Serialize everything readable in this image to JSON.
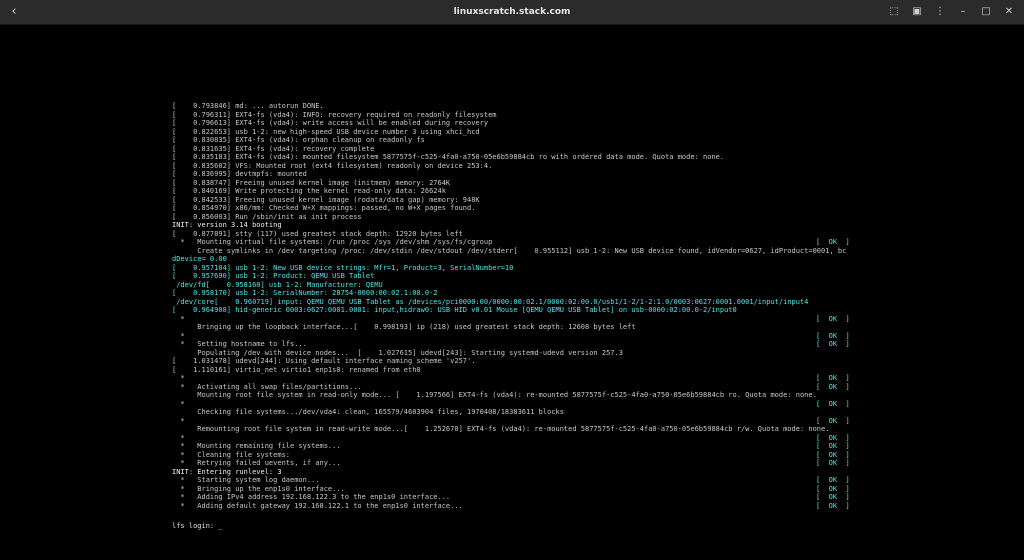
{
  "browser": {
    "title": "linuxscratch.stack.com",
    "back_icon": "back-arrow-icon",
    "icons": [
      "select-region-icon",
      "camera-icon",
      "more-options-icon",
      "minimize-icon",
      "maximize-icon",
      "close-icon"
    ]
  },
  "terminal": {
    "lines": [
      {
        "text": "[    0.793846] md: ... autorun DONE.",
        "cls": "",
        "ok": ""
      },
      {
        "text": "[    0.796311] EXT4-fs (vda4): INFO: recovery required on readonly filesystem",
        "cls": "",
        "ok": ""
      },
      {
        "text": "[    0.796613] EXT4-fs (vda4): write access will be enabled during recovery",
        "cls": "",
        "ok": ""
      },
      {
        "text": "[    0.822653] usb 1-2: new high-speed USB device number 3 using xhci_hcd",
        "cls": "",
        "ok": ""
      },
      {
        "text": "[    0.830835] EXT4-fs (vda4): orphan cleanup on readonly fs",
        "cls": "",
        "ok": ""
      },
      {
        "text": "[    0.831635] EXT4-fs (vda4): recovery complete",
        "cls": "",
        "ok": ""
      },
      {
        "text": "[    0.835183] EXT4-fs (vda4): mounted filesystem 5877575f-c525-4fa0-a750-05e6b59884cb ro with ordered data mode. Quota mode: none.",
        "cls": "",
        "ok": ""
      },
      {
        "text": "[    0.835602] VFS: Mounted root (ext4 filesystem) readonly on device 253:4.",
        "cls": "",
        "ok": ""
      },
      {
        "text": "[    0.836995] devtmpfs: mounted",
        "cls": "",
        "ok": ""
      },
      {
        "text": "[    0.838747] Freeing unused kernel image (initmem) memory: 2764K",
        "cls": "",
        "ok": ""
      },
      {
        "text": "[    0.840169] Write protecting the kernel read-only data: 26624k",
        "cls": "",
        "ok": ""
      },
      {
        "text": "[    0.842533] Freeing unused kernel image (rodata/data gap) memory: 948K",
        "cls": "",
        "ok": ""
      },
      {
        "text": "[    0.854970] x86/mm: Checked W+X mappings: passed, no W+X pages found.",
        "cls": "",
        "ok": ""
      },
      {
        "text": "[    0.856003] Run /sbin/init as init process",
        "cls": "",
        "ok": ""
      },
      {
        "text": "INIT: version 3.14 booting",
        "cls": "bright",
        "ok": ""
      },
      {
        "text": "[    0.877891] stty (117) used greatest stack depth: 12920 bytes left",
        "cls": "",
        "ok": ""
      },
      {
        "text": "  *   Mounting virtual file systems: /run /proc /sys /dev/shm /sys/fs/cgroup",
        "cls": "",
        "ok": "[  OK  ]"
      },
      {
        "text": "      Create symlinks in /dev targeting /proc: /dev/stdin /dev/stdout /dev/stderr[    0.955112] usb 1-2: New USB device found, idVendor=0627, idProduct=0001, bc",
        "cls": "",
        "ok": ""
      },
      {
        "text": "dDevice= 0.00",
        "cls": "cyan",
        "ok": ""
      },
      {
        "text": "[    0.957104] usb 1-2: New USB device strings: Mfr=1, Product=3, SerialNumber=10",
        "cls": "cyan",
        "ok": ""
      },
      {
        "text": "[    0.957690] usb 1-2: Product: QEMU USB Tablet",
        "cls": "cyan",
        "ok": ""
      },
      {
        "text": " /dev/fd[    0.958160] usb 1-2: Manufacturer: QEMU",
        "cls": "cyan",
        "ok": ""
      },
      {
        "text": "[    0.958170] usb 1-2: SerialNumber: 28754-0000:00:02.1:00.0-2",
        "cls": "cyan",
        "ok": ""
      },
      {
        "text": " /dev/core[    0.960719] input: QEMU QEMU USB Tablet as /devices/pci0000:00/0000:00:02.1/0000:02:00.0/usb1/1-2/1-2:1.0/0003:0627:0001.0001/input/input4",
        "cls": "cyan",
        "ok": ""
      },
      {
        "text": "[    0.964908] hid-generic 0003:0627:0001.0001: input,hidraw0: USB HID v0.01 Mouse [QEMU QEMU USB Tablet] on usb-0000:02:00.0-2/input0",
        "cls": "cyan",
        "ok": ""
      },
      {
        "text": "  *",
        "cls": "",
        "ok": "[  OK  ]"
      },
      {
        "text": "      Bringing up the loopback interface...[    0.998193] ip (218) used greatest stack depth: 12608 bytes left",
        "cls": "",
        "ok": ""
      },
      {
        "text": "  *",
        "cls": "",
        "ok": "[  OK  ]"
      },
      {
        "text": "  *   Setting hostname to lfs...",
        "cls": "",
        "ok": "[  OK  ]"
      },
      {
        "text": "      Populating /dev with device nodes...  [    1.027615] udevd[243]: Starting systemd-udevd version 257.3",
        "cls": "",
        "ok": ""
      },
      {
        "text": "[    1.031478] udevd[244]: Using default interface naming scheme 'v257'.",
        "cls": "",
        "ok": ""
      },
      {
        "text": "[    1.110161] virtio_net virtio1 enp1s0: renamed from eth0",
        "cls": "",
        "ok": ""
      },
      {
        "text": "  *",
        "cls": "",
        "ok": "[  OK  ]"
      },
      {
        "text": "  *   Activating all swap files/partitions...",
        "cls": "",
        "ok": "[  OK  ]"
      },
      {
        "text": "      Mounting root file system in read-only mode... [    1.197566] EXT4-fs (vda4): re-mounted 5877575f-c525-4fa0-a750-05e6b59884cb ro. Quota mode: none.",
        "cls": "",
        "ok": ""
      },
      {
        "text": "  *",
        "cls": "",
        "ok": "[  OK  ]"
      },
      {
        "text": "      Checking file systems.../dev/vda4: clean, 165579/4603904 files, 1970408/18383611 blocks",
        "cls": "",
        "ok": ""
      },
      {
        "text": "  *",
        "cls": "",
        "ok": "[  OK  ]"
      },
      {
        "text": "      Remounting root file system in read-write mode...[    1.252670] EXT4-fs (vda4): re-mounted 5877575f-c525-4fa0-a750-05e6b59884cb r/w. Quota mode: none.",
        "cls": "",
        "ok": ""
      },
      {
        "text": "  *",
        "cls": "",
        "ok": "[  OK  ]"
      },
      {
        "text": "  *   Mounting remaining file systems...",
        "cls": "",
        "ok": "[  OK  ]"
      },
      {
        "text": "  *   Cleaning file systems:",
        "cls": "",
        "ok": "[  OK  ]"
      },
      {
        "text": "  *   Retrying failed uevents, if any...",
        "cls": "",
        "ok": "[  OK  ]"
      },
      {
        "text": "INIT: Entering runlevel: 3",
        "cls": "bright",
        "ok": ""
      },
      {
        "text": "  *   Starting system log daemon...",
        "cls": "",
        "ok": "[  OK  ]"
      },
      {
        "text": "  *   Bringing up the enp1s0 interface...",
        "cls": "",
        "ok": "[  OK  ]"
      },
      {
        "text": "  *   Adding IPv4 address 192.168.122.3 to the enp1s0 interface...",
        "cls": "",
        "ok": "[  OK  ]"
      },
      {
        "text": "  *   Adding default gateway 192.168.122.1 to the enp1s0 interface...",
        "cls": "",
        "ok": "[  OK  ]"
      }
    ],
    "login_prompt": "lfs login: _"
  }
}
